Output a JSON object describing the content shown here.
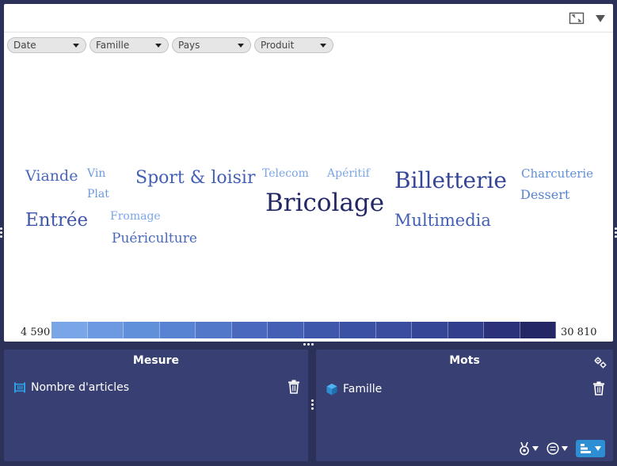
{
  "filters": [
    {
      "label": "Date"
    },
    {
      "label": "Famille"
    },
    {
      "label": "Pays"
    },
    {
      "label": "Produit"
    }
  ],
  "words": [
    {
      "text": "Viande",
      "value": 15000
    },
    {
      "text": "Vin",
      "value": 6000
    },
    {
      "text": "Plat",
      "value": 6100
    },
    {
      "text": "Sport & loisir",
      "value": 17500
    },
    {
      "text": "Telecom",
      "value": 5400
    },
    {
      "text": "Apéritif",
      "value": 4590
    },
    {
      "text": "Billetterie",
      "value": 24500
    },
    {
      "text": "Charcuterie",
      "value": 9500
    },
    {
      "text": "Dessert",
      "value": 11500
    },
    {
      "text": "Entrée",
      "value": 19500
    },
    {
      "text": "Fromage",
      "value": 5500
    },
    {
      "text": "Bricolage",
      "value": 30810
    },
    {
      "text": "Multimedia",
      "value": 17000
    },
    {
      "text": "Puériculture",
      "value": 14500
    }
  ],
  "legend": {
    "min_label": "4 590",
    "max_label": "30 810",
    "min": 4590,
    "max": 30810,
    "colors": [
      "#7aa6e8",
      "#6c99e1",
      "#6190db",
      "#5883d3",
      "#5278c9",
      "#4a68bd",
      "#4460b4",
      "#3f57aa",
      "#3b51a4",
      "#3a4d9e",
      "#354696",
      "#323f8c",
      "#2b327a",
      "#232765"
    ]
  },
  "measure_panel": {
    "title": "Mesure",
    "field": "Nombre d'articles"
  },
  "words_panel": {
    "title": "Mots",
    "field": "Famille"
  },
  "colors": {
    "background": "#2b3158",
    "panel": "#384073",
    "accent_button": "#2d8ed4",
    "word_dark": "#232765",
    "word_light": "#7aa6e8"
  }
}
